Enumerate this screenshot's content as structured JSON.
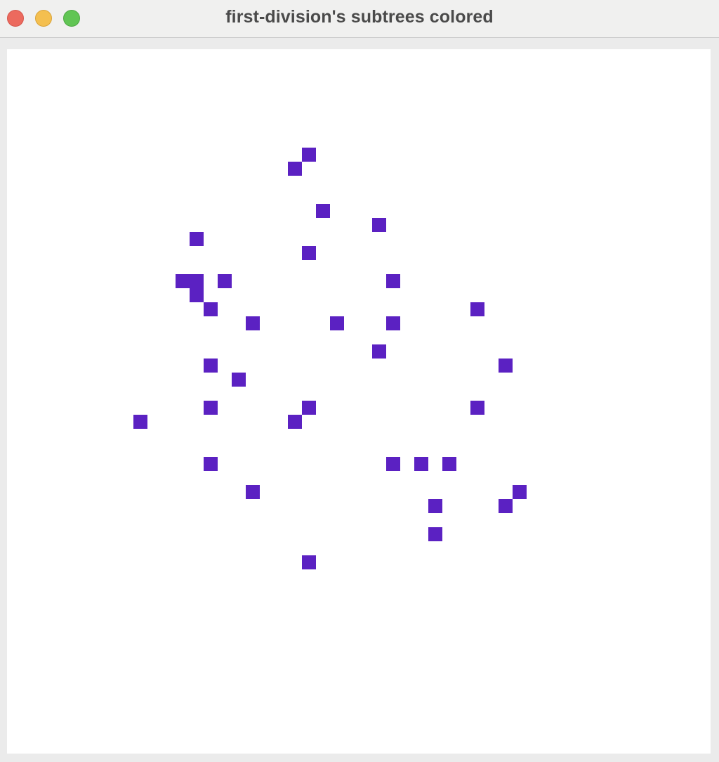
{
  "window": {
    "title": "first-division's subtrees colored",
    "buttons": {
      "close": {
        "color": "#ec6a5e",
        "border": "#d5574d"
      },
      "minimize": {
        "color": "#f4bf4f",
        "border": "#d9a33a"
      },
      "zoom": {
        "color": "#61c554",
        "border": "#4ea843"
      }
    }
  },
  "canvas": {
    "background": "#ffffff",
    "cell_color": "#5b21c2"
  }
}
